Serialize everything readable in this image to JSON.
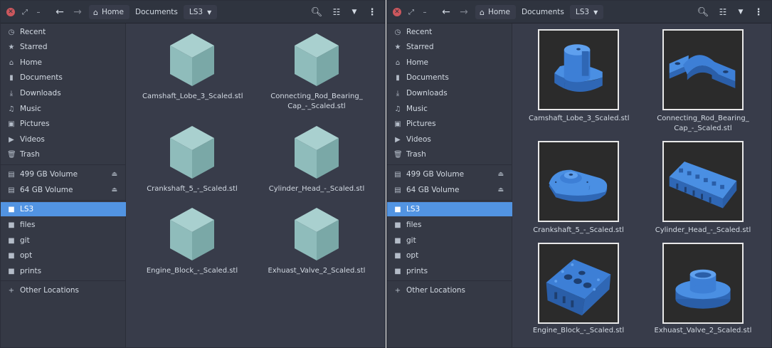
{
  "breadcrumbs": [
    "Home",
    "Documents",
    "LS3"
  ],
  "icons": {
    "close": "close-icon",
    "maximize": "maximize-icon",
    "minimize": "minimize-icon",
    "back": "arrow-left-icon",
    "forward": "arrow-right-icon",
    "home": "home-icon",
    "search": "search-icon",
    "view": "view-list-icon",
    "sort": "chevron-down-icon",
    "menu": "kebab-menu-icon"
  },
  "sidebar": {
    "places": [
      "Recent",
      "Starred",
      "Home",
      "Documents",
      "Downloads",
      "Music",
      "Pictures",
      "Videos",
      "Trash"
    ],
    "volumes": [
      "499 GB Volume",
      "64 GB Volume"
    ],
    "bookmarks": [
      "LS3",
      "files",
      "git",
      "opt",
      "prints"
    ],
    "other": "Other Locations",
    "active": "LS3"
  },
  "files": [
    "Camshaft_Lobe_3_Scaled.stl",
    "Connecting_Rod_Bearing_\nCap_-_Scaled.stl",
    "Crankshaft_5_-_Scaled.stl",
    "Cylinder_Head_-_Scaled.stl",
    "Engine_Block_-_Scaled.stl",
    "Exhuast_Valve_2_Scaled.stl"
  ],
  "colors": {
    "window_bg": "#383c4a",
    "sidebar_bg": "#353945",
    "headerbar_bg": "#2f343f",
    "accent": "#5294e2",
    "cube": "#8fbcbb",
    "model_blue": "#3d7fd6"
  }
}
